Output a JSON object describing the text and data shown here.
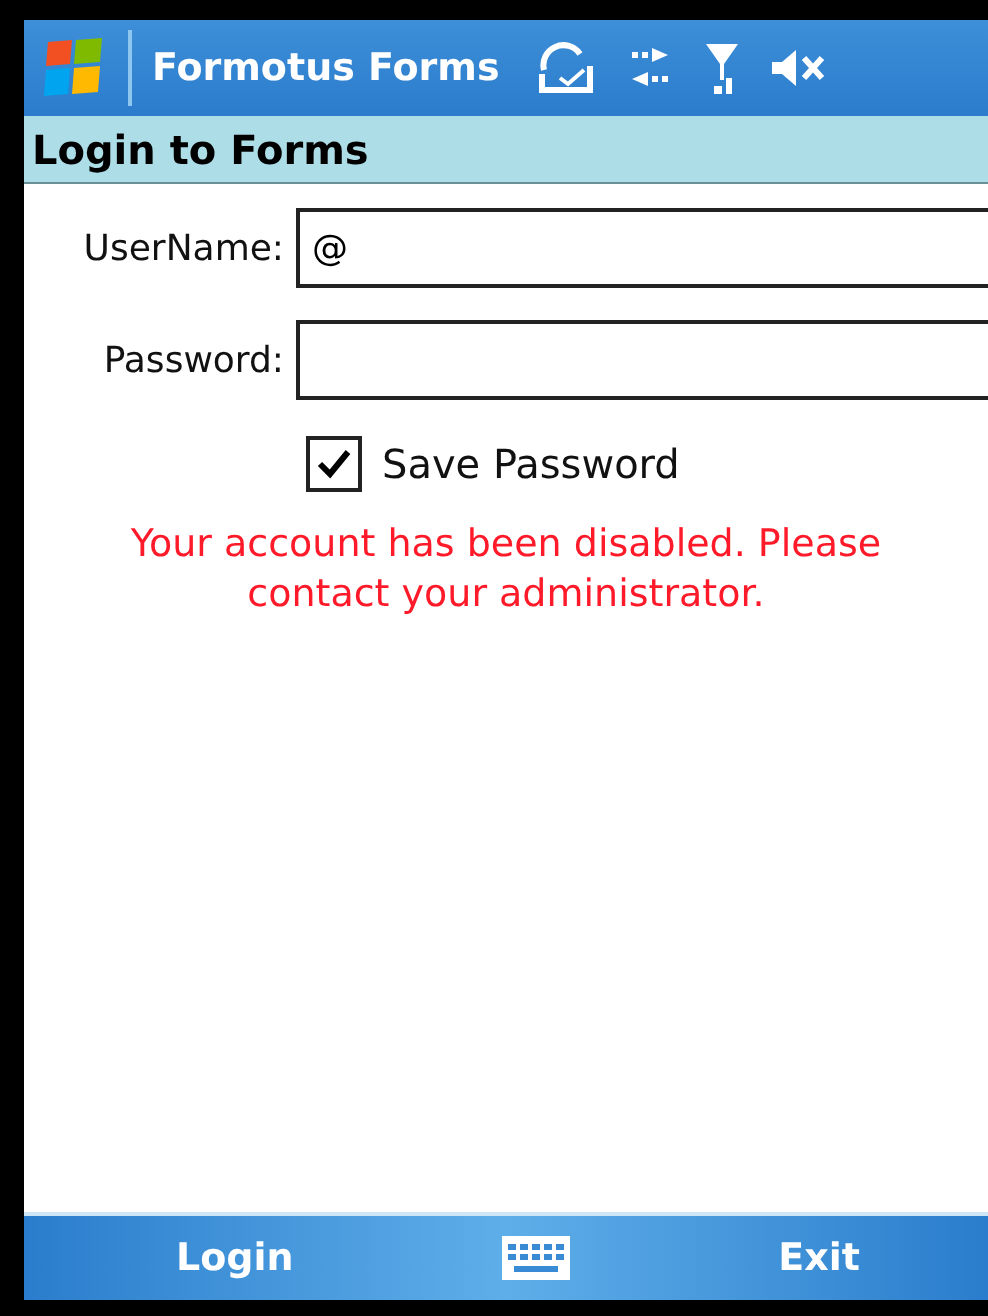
{
  "title_bar": {
    "title": "Formotus Forms"
  },
  "header": "Login to Forms",
  "fields": [
    {
      "label": "UserName:",
      "value": "@"
    },
    {
      "label": "Password:"
    }
  ],
  "save_password": {
    "label": "Save Password",
    "checked": true
  },
  "error": "Your account has been disabled. Please contact your administrator.",
  "menu_bar": {
    "left": "Login",
    "right": "Exit"
  }
}
